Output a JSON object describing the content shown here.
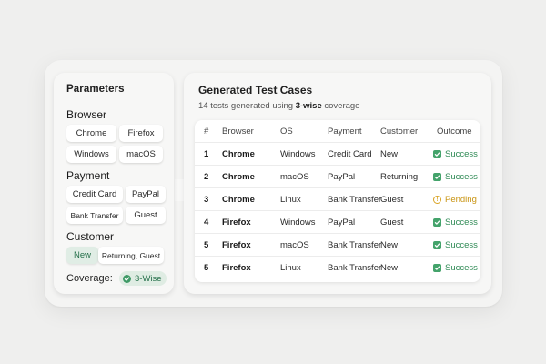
{
  "parameters": {
    "title": "Parameters",
    "browser": {
      "label": "Browser",
      "options": [
        "Chrome",
        "Firefox",
        "Windows",
        "macOS"
      ]
    },
    "payment": {
      "label": "Payment",
      "options": [
        "Credit Card",
        "PayPal",
        "Bank Transfer",
        "Guest"
      ]
    },
    "customer": {
      "label": "Customer",
      "options": [
        "New",
        "Returning, Guest"
      ],
      "selected": "New"
    },
    "coverage": {
      "label": "Coverage:",
      "value": "3-Wise"
    }
  },
  "results": {
    "title": "Generated Test Cases",
    "subtitle_prefix": "14 tests generated using ",
    "subtitle_strength": "3-wise",
    "subtitle_suffix": " coverage",
    "columns": [
      "#",
      "Browser",
      "OS",
      "Payment",
      "Customer",
      "Outcome"
    ],
    "rows": [
      {
        "num": "1",
        "browser": "Chrome",
        "os": "Windows",
        "payment": "Credit Card",
        "customer": "New",
        "outcome": "Success",
        "status": "success"
      },
      {
        "num": "2",
        "browser": "Chrome",
        "os": "macOS",
        "payment": "PayPal",
        "customer": "Returning",
        "outcome": "Success",
        "status": "success"
      },
      {
        "num": "3",
        "browser": "Chrome",
        "os": "Linux",
        "payment": "Bank Transfer",
        "customer": "Guest",
        "outcome": "Pending",
        "status": "pending"
      },
      {
        "num": "4",
        "browser": "Firefox",
        "os": "Windows",
        "payment": "PayPal",
        "customer": "Guest",
        "outcome": "Success",
        "status": "success"
      },
      {
        "num": "5",
        "browser": "Firefox",
        "os": "macOS",
        "payment": "Bank Transfer",
        "customer": "New",
        "outcome": "Success",
        "status": "success"
      },
      {
        "num": "5",
        "browser": "Firefox",
        "os": "Linux",
        "payment": "Bank Transfer",
        "customer": "New",
        "outcome": "Success",
        "status": "success"
      }
    ]
  },
  "colors": {
    "success": "#2f8a55",
    "pending": "#c99412",
    "selected_chip_bg": "#e0ede5"
  },
  "icons": {
    "success": "check-square-icon",
    "pending": "exclamation-circle-icon",
    "coverage": "check-circle-icon",
    "flow": "arrow-right-icon"
  }
}
